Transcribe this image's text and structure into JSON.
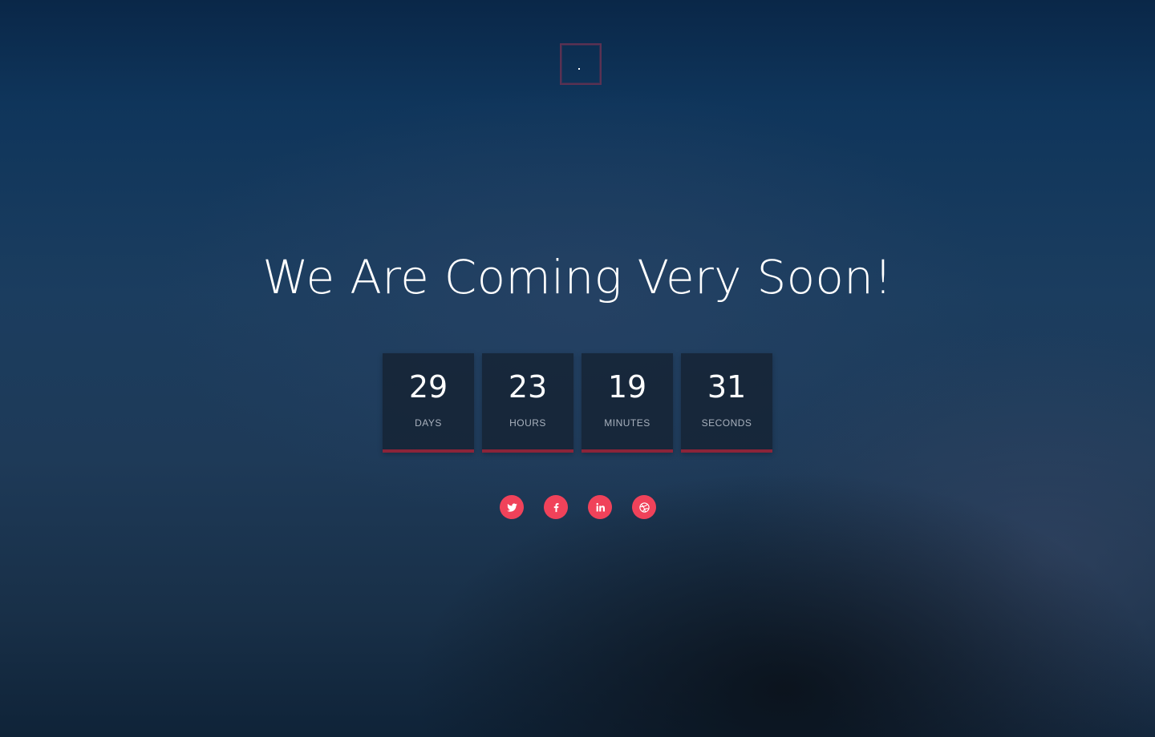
{
  "logo": {
    "icon": "square-logo-icon",
    "accent_color": "#5b3152"
  },
  "headline": "We Are Coming Very Soon!",
  "countdown": [
    {
      "value": "29",
      "label": "DAYS"
    },
    {
      "value": "23",
      "label": "HOURS"
    },
    {
      "value": "19",
      "label": "MINUTES"
    },
    {
      "value": "31",
      "label": "SECONDS"
    }
  ],
  "countdown_accent_color": "#8b2439",
  "social": [
    {
      "icon": "twitter-icon"
    },
    {
      "icon": "facebook-icon"
    },
    {
      "icon": "linkedin-icon"
    },
    {
      "icon": "dribbble-icon"
    }
  ],
  "social_color": "#f0425a"
}
